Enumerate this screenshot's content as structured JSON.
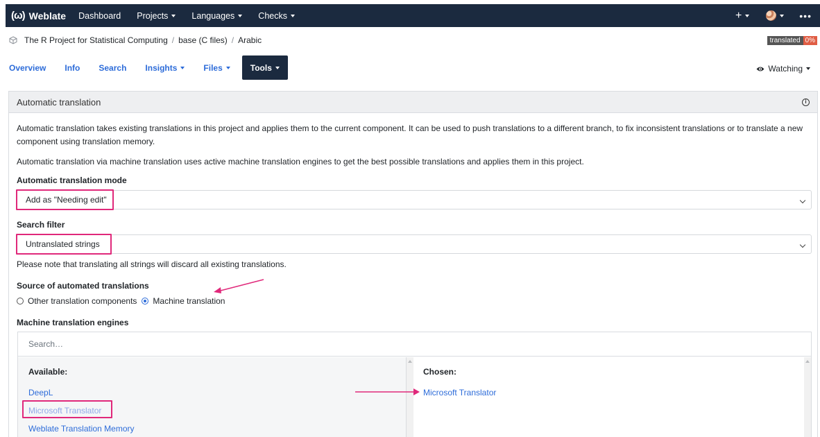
{
  "navbar": {
    "brand": "Weblate",
    "brand_logo": "(ω)",
    "items": [
      {
        "label": "Dashboard",
        "dropdown": false
      },
      {
        "label": "Projects",
        "dropdown": true
      },
      {
        "label": "Languages",
        "dropdown": true
      },
      {
        "label": "Checks",
        "dropdown": true
      }
    ],
    "plus_icon": "plus-icon",
    "more": "•••"
  },
  "breadcrumb": {
    "items": [
      "The R Project for Statistical Computing",
      "base (C files)",
      "Arabic"
    ],
    "separator": "/"
  },
  "status_badge": {
    "label": "translated",
    "value": "0%"
  },
  "tabs": [
    {
      "label": "Overview",
      "dropdown": false
    },
    {
      "label": "Info",
      "dropdown": false
    },
    {
      "label": "Search",
      "dropdown": false
    },
    {
      "label": "Insights",
      "dropdown": true
    },
    {
      "label": "Files",
      "dropdown": true
    },
    {
      "label": "Tools",
      "dropdown": true,
      "active": true
    }
  ],
  "watching": "Watching",
  "panel": {
    "title": "Automatic translation",
    "intro_line1": "Automatic translation takes existing translations in this project and applies them to the current component. It can be used to push translations to a different branch, to fix inconsistent translations or to translate a new",
    "intro_line2": "component using translation memory.",
    "intro2": "Automatic translation via machine translation uses active machine translation engines to get the best possible translations and applies them in this project.",
    "mode_label": "Automatic translation mode",
    "mode_value": "Add as \"Needing edit\"",
    "filter_label": "Search filter",
    "filter_value": "Untranslated strings",
    "filter_note": "Please note that translating all strings will discard all existing translations.",
    "source_label": "Source of automated translations",
    "source_options": [
      {
        "label": "Other translation components",
        "checked": false
      },
      {
        "label": "Machine translation",
        "checked": true
      }
    ],
    "engines_label": "Machine translation engines",
    "engines_search_placeholder": "Search…",
    "available_title": "Available:",
    "available": [
      "DeepL",
      "Microsoft Translator",
      "Weblate Translation Memory"
    ],
    "chosen_title": "Chosen:",
    "chosen": [
      "Microsoft Translator"
    ]
  },
  "colors": {
    "navbar_bg": "#1b2a3f",
    "link": "#2d6cd9",
    "highlight": "#e0287a",
    "badge_red": "#e05d44"
  }
}
